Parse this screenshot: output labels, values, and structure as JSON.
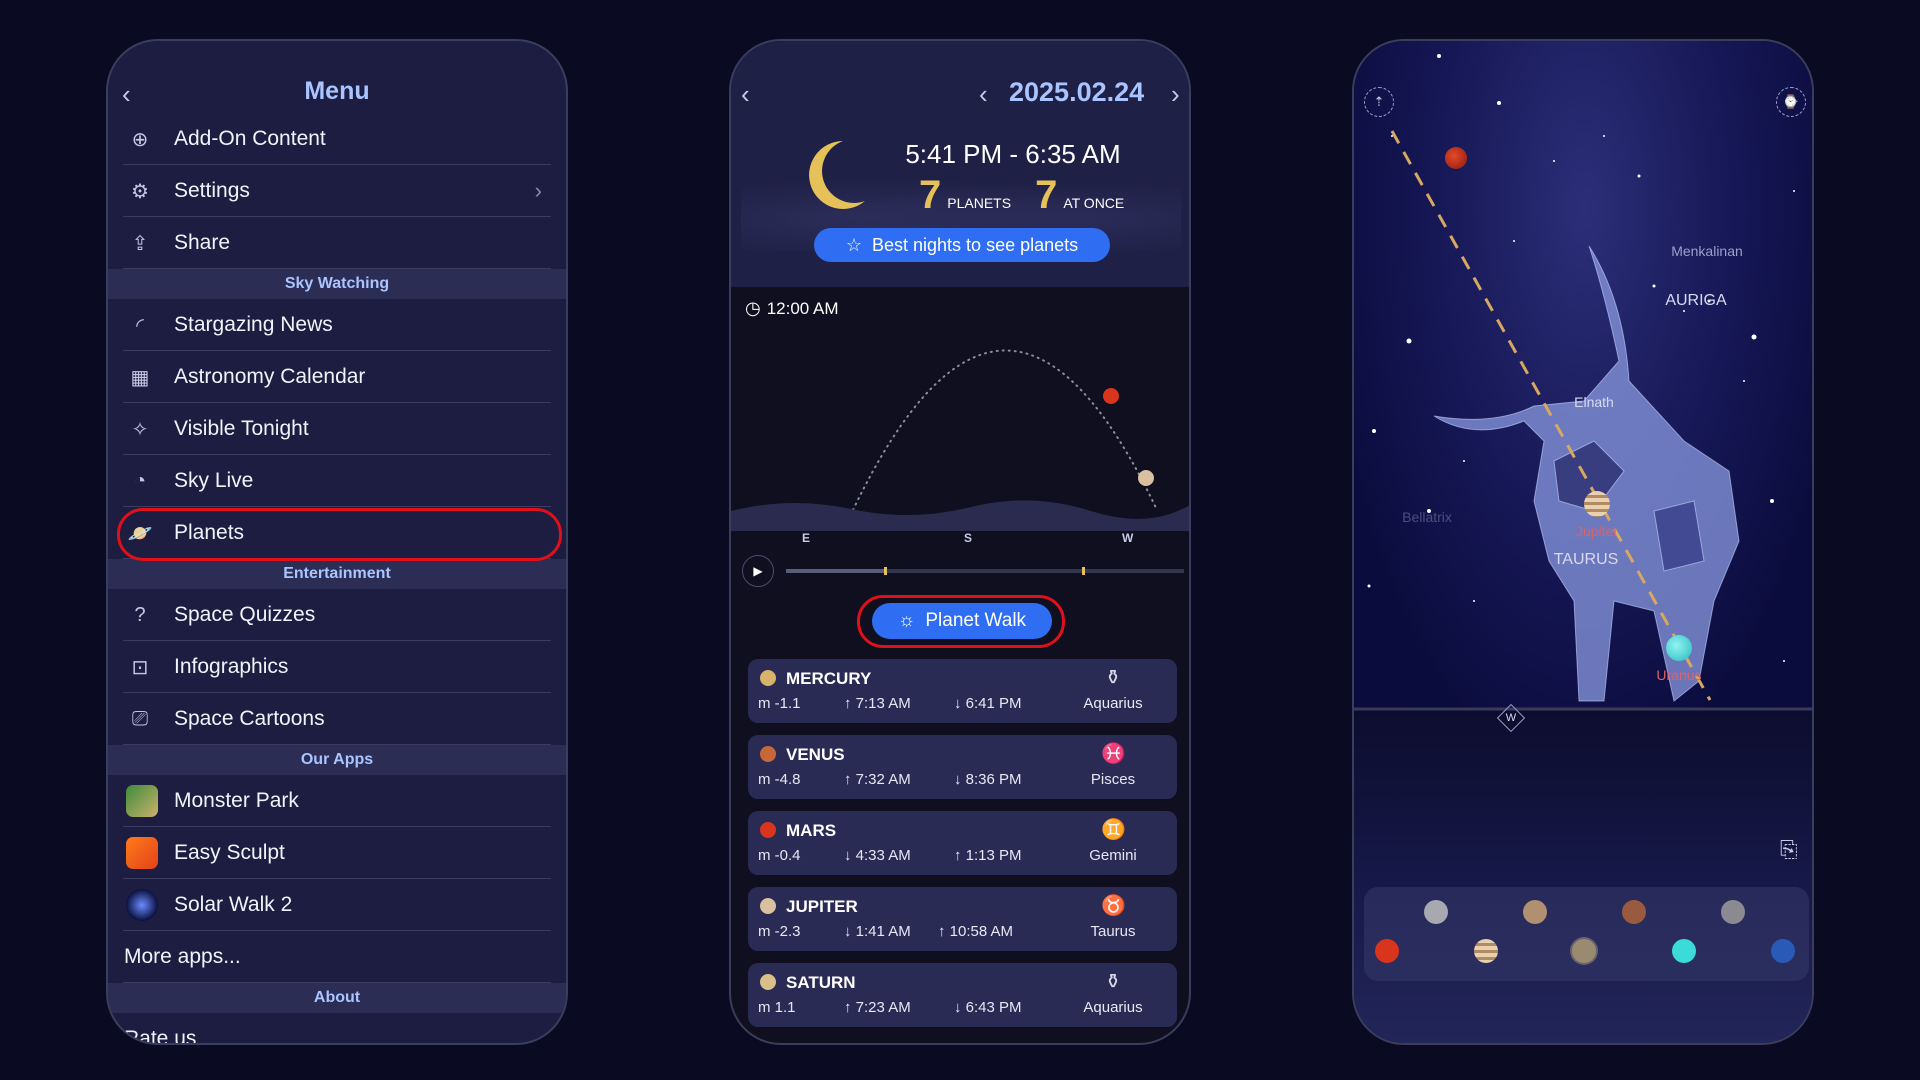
{
  "menu": {
    "title": "Menu",
    "items_top": [
      {
        "label": "Add-On Content",
        "icon": "plus-circle-icon"
      },
      {
        "label": "Settings",
        "icon": "gear-icon"
      },
      {
        "label": "Share",
        "icon": "share-icon"
      }
    ],
    "section_sky": "Sky Watching",
    "items_sky": [
      {
        "label": "Stargazing News",
        "icon": "rss-icon"
      },
      {
        "label": "Astronomy Calendar",
        "icon": "calendar-icon"
      },
      {
        "label": "Visible Tonight",
        "icon": "star-circle-icon"
      },
      {
        "label": "Sky Live",
        "icon": "sky-live-icon"
      },
      {
        "label": "Planets",
        "icon": "planet-icon"
      }
    ],
    "section_ent": "Entertainment",
    "items_ent": [
      {
        "label": "Space Quizzes",
        "icon": "quiz-icon"
      },
      {
        "label": "Infographics",
        "icon": "infographic-icon"
      },
      {
        "label": "Space Cartoons",
        "icon": "camera-icon"
      }
    ],
    "section_apps": "Our Apps",
    "items_apps": [
      {
        "label": "Monster Park"
      },
      {
        "label": "Easy Sculpt"
      },
      {
        "label": "Solar Walk 2"
      }
    ],
    "more_apps": "More apps...",
    "section_about": "About",
    "rate_us": "Rate us"
  },
  "planets": {
    "date": "2025.02.24",
    "night_range": "5:41 PM - 6:35 AM",
    "planets_count": "7",
    "planets_label": "PLANETS",
    "at_once_count": "7",
    "at_once_label": "AT ONCE",
    "best_nights": "Best nights to see planets",
    "time": "12:00 AM",
    "directions": [
      "E",
      "S",
      "W"
    ],
    "planet_walk": "Planet Walk",
    "list": [
      {
        "name": "MERCURY",
        "mag": "m -1.1",
        "t1": "↑ 7:13 AM",
        "t2": "↓ 6:41 PM",
        "constellation": "Aquarius",
        "color": "#d9b36a"
      },
      {
        "name": "VENUS",
        "mag": "m -4.8",
        "t1": "↑ 7:32 AM",
        "t2": "↓ 8:36 PM",
        "constellation": "Pisces",
        "color": "#c8683a"
      },
      {
        "name": "MARS",
        "mag": "m -0.4",
        "t1": "↓ 4:33 AM",
        "t2": "↑ 1:13 PM",
        "constellation": "Gemini",
        "color": "#d8351c"
      },
      {
        "name": "JUPITER",
        "mag": "m -2.3",
        "t1": "↓ 1:41 AM",
        "t2": "↑ 10:58 AM",
        "constellation": "Taurus",
        "color": "#d8c0a0"
      },
      {
        "name": "SATURN",
        "mag": "m 1.1",
        "t1": "↑ 7:23 AM",
        "t2": "↓ 6:43 PM",
        "constellation": "Aquarius",
        "color": "#d9bf8a"
      }
    ]
  },
  "sky": {
    "labels": {
      "menkalinan": "Menkalinan",
      "auriga": "AURIGA",
      "elnath": "Elnath",
      "bellatrix": "Bellatrix",
      "jupiter": "Jupiter",
      "taurus": "TAURUS",
      "uranus": "Uranus",
      "west": "W"
    },
    "accent_label_color": "#e0606a"
  }
}
